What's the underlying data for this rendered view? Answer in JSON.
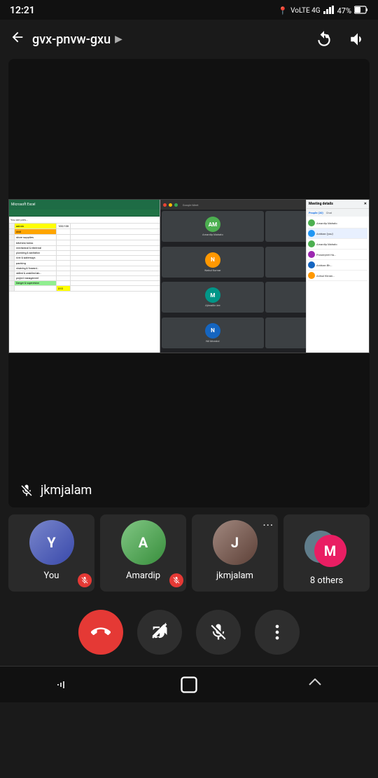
{
  "statusBar": {
    "time": "12:21",
    "networkType": "VoLTE 4G",
    "signalBars": "▂▄▆",
    "battery": "47%",
    "icons": [
      "location-icon",
      "signal-icon",
      "battery-icon"
    ]
  },
  "topBar": {
    "backLabel": "←",
    "meetingCode": "gvx-pnvw-gxu",
    "arrowLabel": "▶",
    "rotateCamLabel": "rotate-cam",
    "volumeLabel": "volume"
  },
  "mainVideo": {
    "presenterName": "jkmjalam",
    "presenterMuted": true
  },
  "participants": [
    {
      "id": "you",
      "name": "You",
      "muted": true,
      "avatarType": "photo-person",
      "avatarLabel": "Y"
    },
    {
      "id": "amardip",
      "name": "Amardip",
      "muted": true,
      "avatarType": "photo-green",
      "avatarLabel": "A"
    },
    {
      "id": "jkmjalam",
      "name": "jkmjalam",
      "muted": false,
      "avatarType": "photo-brown",
      "avatarLabel": "J",
      "hasDots": true
    },
    {
      "id": "others",
      "name": "8 others",
      "muted": false,
      "avatarType": "others",
      "avatarLabel": "M"
    }
  ],
  "controls": {
    "endCall": "end-call",
    "camera": "camera-off",
    "mic": "mic-off",
    "more": "more-options"
  },
  "meetDetails": {
    "peopleCount": "20",
    "chatLabel": "Chat",
    "peopleLabel": "People",
    "participantNames": [
      "Amardip Mahato",
      "Anirban Bh...",
      "Anuj Kumar",
      "Amardip Mahato",
      "Prosenjeet Ha...",
      "Anirban Bh..."
    ]
  },
  "screenShare": {
    "excelRows": [
      [
        "admin",
        "100/100"
      ],
      [
        "civil",
        ""
      ],
      [
        "store supplies",
        ""
      ],
      [
        "kichen/mess",
        ""
      ],
      [
        "mechanical & electrical",
        ""
      ],
      [
        "plumbing & sanitation",
        ""
      ],
      [
        "river & waterways",
        ""
      ],
      [
        "packing",
        ""
      ],
      [
        "shubring & forward...",
        ""
      ],
      [
        "skilled & unskilled lab...",
        ""
      ],
      [
        "project management",
        ""
      ],
      [
        "Danger & supervision",
        ""
      ],
      [
        "",
        "310"
      ]
    ]
  },
  "navBar": {
    "backLabel": "|||",
    "homeLabel": "○",
    "recentLabel": "◁"
  }
}
